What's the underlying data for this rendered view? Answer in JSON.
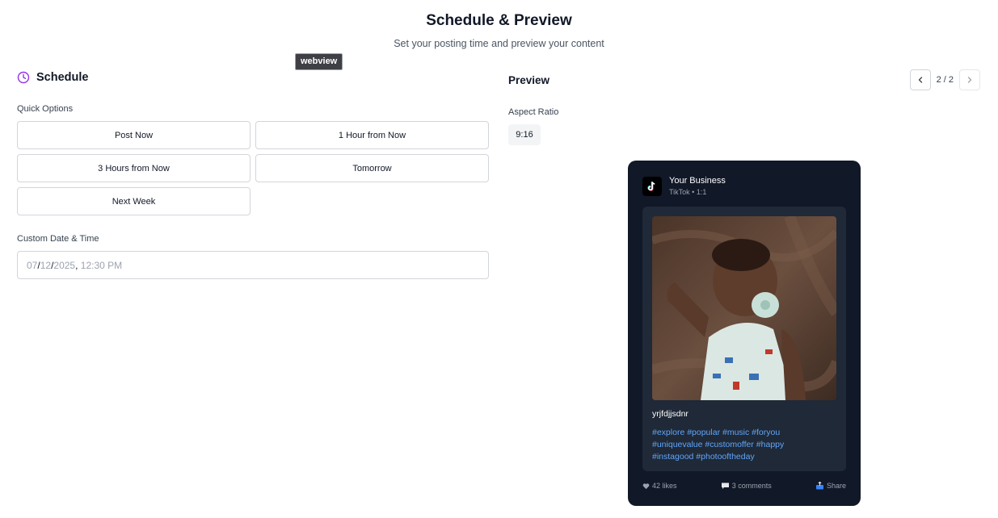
{
  "header": {
    "title": "Schedule & Preview",
    "subtitle": "Set your posting time and preview your content"
  },
  "tooltip": "webview",
  "schedule": {
    "title": "Schedule",
    "quick_options_label": "Quick Options",
    "quick_options": [
      "Post Now",
      "1 Hour from Now",
      "3 Hours from Now",
      "Tomorrow",
      "Next Week"
    ],
    "custom_label": "Custom Date & Time",
    "date_value": {
      "month": "07",
      "day": "12",
      "year": "2025",
      "sep1": "/",
      "sep2": "/",
      "sep3": ",",
      "time": "12:30 PM"
    }
  },
  "preview": {
    "title": "Preview",
    "pager": "2 / 2",
    "aspect_label": "Aspect Ratio",
    "aspect_value": "9:16",
    "post": {
      "account_name": "Your Business",
      "account_meta": "TikTok • 1:1",
      "caption": "yrjfdjjsdnr",
      "hashtags": "#explore #popular #music #foryou #uniquevalue #customoffer #happy #instagood #photooftheday",
      "likes": "42 likes",
      "comments": "3 comments",
      "share": "Share"
    }
  },
  "colors": {
    "accent": "#9333ea",
    "card_dark": "#111827",
    "hashtag": "#60a5fa"
  }
}
